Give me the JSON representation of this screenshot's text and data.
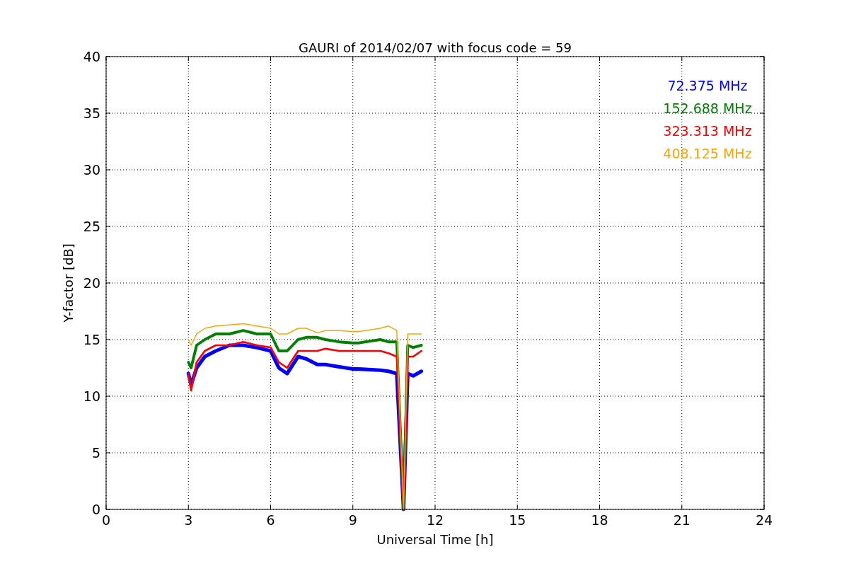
{
  "figure": {
    "chart_data": {
      "type": "line",
      "title": "GAURI of 2014/02/07 with focus code = 59",
      "xlabel": "Universal Time [h]",
      "ylabel": "Y-factor [dB]",
      "x": [
        3,
        3.1,
        3.3,
        3.6,
        4,
        4.5,
        5,
        5.5,
        6,
        6.3,
        6.6,
        7,
        7.3,
        7.7,
        8,
        8.5,
        9,
        9.2,
        10,
        10.3,
        10.6,
        10.85,
        11,
        11.2,
        11.5
      ],
      "series": [
        {
          "name": "72.375 MHz",
          "color": "#0000ff",
          "values": [
            12,
            11,
            12.5,
            13.5,
            14,
            14.5,
            14.5,
            14.3,
            14,
            12.5,
            12,
            13.5,
            13.3,
            12.8,
            12.8,
            12.6,
            12.4,
            12.4,
            12.3,
            12.2,
            12,
            0,
            12,
            11.8,
            12.2
          ]
        },
        {
          "name": "152.688 MHz",
          "color": "#008000",
          "values": [
            13,
            12.5,
            14.5,
            15,
            15.5,
            15.5,
            15.8,
            15.5,
            15.5,
            14,
            14,
            15,
            15.2,
            15.2,
            15,
            14.8,
            14.7,
            14.7,
            15,
            14.8,
            14.8,
            0,
            14.5,
            14.3,
            14.5
          ]
        },
        {
          "name": "323.313 MHz",
          "color": "#ff0000",
          "values": [
            12,
            10.5,
            13,
            14,
            14.5,
            14.5,
            14.8,
            14.5,
            14.3,
            13,
            12.5,
            14,
            14,
            14,
            14.2,
            14,
            14,
            14,
            14,
            13.8,
            13.5,
            0,
            13.5,
            13.5,
            14
          ]
        },
        {
          "name": "408.125 MHz",
          "color": "#ffa500",
          "values": [
            15,
            14.5,
            15.5,
            16,
            16.2,
            16.3,
            16.4,
            16.2,
            16,
            15.5,
            15.5,
            16,
            16,
            15.6,
            15.8,
            15.8,
            15.7,
            15.7,
            16,
            16.2,
            15.8,
            0,
            15.5,
            15.5,
            15.5
          ]
        }
      ],
      "grid": true,
      "xlim": [
        0,
        24
      ],
      "ylim": [
        0,
        40
      ],
      "xticks": [
        0,
        3,
        6,
        9,
        12,
        15,
        18,
        21,
        24
      ],
      "yticks": [
        0,
        5,
        10,
        15,
        20,
        25,
        30,
        35,
        40
      ]
    }
  }
}
